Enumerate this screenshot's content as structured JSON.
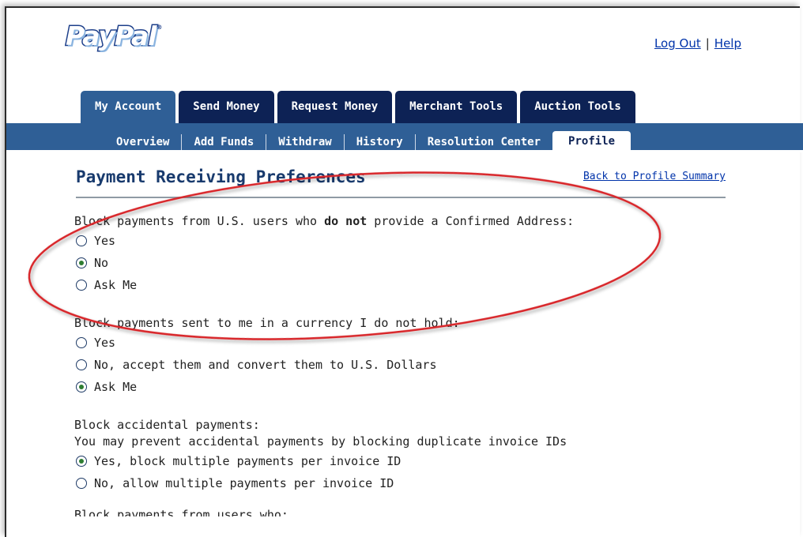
{
  "header": {
    "logo": "PayPal",
    "logo_mark": "®",
    "logout": "Log Out",
    "sep": "|",
    "help": "Help"
  },
  "tabs": [
    {
      "label": "My Account"
    },
    {
      "label": "Send Money"
    },
    {
      "label": "Request Money"
    },
    {
      "label": "Merchant Tools"
    },
    {
      "label": "Auction Tools"
    }
  ],
  "subnav": [
    {
      "label": "Overview"
    },
    {
      "label": "Add Funds"
    },
    {
      "label": "Withdraw"
    },
    {
      "label": "History"
    },
    {
      "label": "Resolution Center"
    },
    {
      "label": "Profile"
    }
  ],
  "page": {
    "title": "Payment Receiving Preferences",
    "back_link": "Back to Profile Summary"
  },
  "section1": {
    "question_pre": "Block payments from U.S. users who ",
    "question_bold": "do not",
    "question_post": " provide a Confirmed Address:",
    "options": [
      "Yes",
      "No",
      "Ask Me"
    ],
    "selected": "No"
  },
  "section2": {
    "question": "Block payments sent to me in a currency I do not hold:",
    "options": [
      "Yes",
      "No, accept them and convert them to U.S. Dollars",
      "Ask Me"
    ],
    "selected": "Ask Me"
  },
  "section3": {
    "question": "Block accidental payments:",
    "subtext": "You may prevent accidental payments by blocking duplicate invoice IDs",
    "options": [
      "Yes, block multiple payments per invoice ID",
      "No, allow multiple payments per invoice ID"
    ],
    "selected": "Yes, block multiple payments per invoice ID"
  },
  "section4": {
    "question_partial": "Block payments from users who:"
  }
}
